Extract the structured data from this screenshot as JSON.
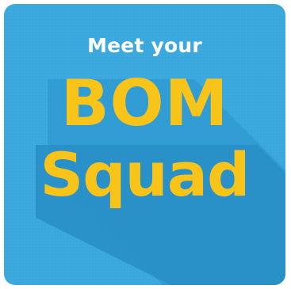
{
  "tile": {
    "background_color": "#3ba8dd",
    "shadow_color": "#2a8fc6",
    "kicker": "Meet your",
    "line1": "BOM",
    "line2": "Squad",
    "kicker_color": "#ffffff",
    "title_color": "#f8c41a"
  }
}
